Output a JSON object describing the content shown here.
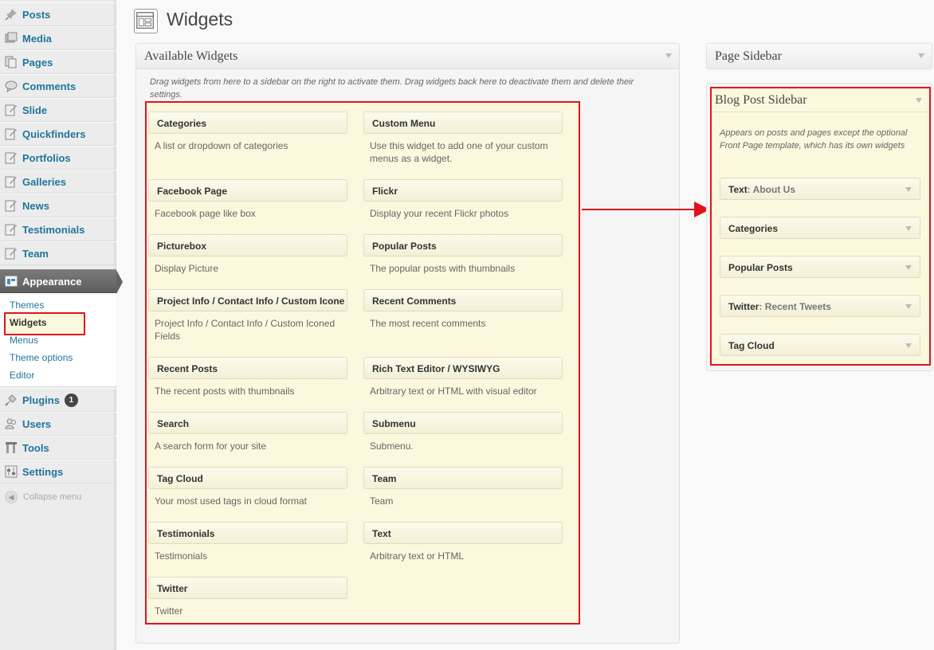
{
  "menu": {
    "items_top": [
      {
        "name": "menu-item-posts",
        "icon": "pin-icon",
        "label": "Posts"
      },
      {
        "name": "menu-item-media",
        "icon": "media-icon",
        "label": "Media"
      },
      {
        "name": "menu-item-pages",
        "icon": "pages-icon",
        "label": "Pages"
      },
      {
        "name": "menu-item-comments",
        "icon": "comment-icon",
        "label": "Comments"
      },
      {
        "name": "menu-item-slide",
        "icon": "edit-icon",
        "label": "Slide"
      },
      {
        "name": "menu-item-quickfinders",
        "icon": "edit-icon",
        "label": "Quickfinders"
      },
      {
        "name": "menu-item-portfolios",
        "icon": "edit-icon",
        "label": "Portfolios"
      },
      {
        "name": "menu-item-galleries",
        "icon": "edit-icon",
        "label": "Galleries"
      },
      {
        "name": "menu-item-news",
        "icon": "edit-icon",
        "label": "News"
      },
      {
        "name": "menu-item-testimonials",
        "icon": "edit-icon",
        "label": "Testimonials"
      },
      {
        "name": "menu-item-team",
        "icon": "edit-icon",
        "label": "Team"
      }
    ],
    "appearance": "Appearance",
    "submenu": [
      "Themes",
      "Widgets",
      "Menus",
      "Theme options",
      "Editor"
    ],
    "items_bottom": [
      {
        "label": "Plugins",
        "icon": "plugin-icon"
      },
      {
        "label": "Users",
        "icon": "users-icon"
      },
      {
        "label": "Tools",
        "icon": "tools-icon"
      },
      {
        "label": "Settings",
        "icon": "settings-icon"
      }
    ],
    "plugins_badge": "1",
    "collapse": "Collapse menu"
  },
  "page": {
    "title": "Widgets",
    "icon": "widgets-page-icon"
  },
  "available": {
    "title": "Available Widgets",
    "description": "Drag widgets from here to a sidebar on the right to activate them. Drag widgets back here to deactivate them and delete their settings.",
    "widgets": [
      {
        "title": "Categories",
        "desc": "A list or dropdown of categories"
      },
      {
        "title": "Custom Menu",
        "desc": "Use this widget to add one of your custom menus as a widget."
      },
      {
        "title": "Facebook Page",
        "desc": "Facebook page like box"
      },
      {
        "title": "Flickr",
        "desc": "Display your recent Flickr photos"
      },
      {
        "title": "Picturebox",
        "desc": "Display Picture"
      },
      {
        "title": "Popular Posts",
        "desc": "The popular posts with thumbnails"
      },
      {
        "title": "Project Info / Contact Info / Custom Icone",
        "desc": "Project Info / Contact Info / Custom Iconed Fields"
      },
      {
        "title": "Recent Comments",
        "desc": "The most recent comments"
      },
      {
        "title": "Recent Posts",
        "desc": "The recent posts with thumbnails"
      },
      {
        "title": "Rich Text Editor / WYSIWYG",
        "desc": "Arbitrary text or HTML with visual editor"
      },
      {
        "title": "Search",
        "desc": "A search form for your site"
      },
      {
        "title": "Submenu",
        "desc": "Submenu."
      },
      {
        "title": "Tag Cloud",
        "desc": "Your most used tags in cloud format"
      },
      {
        "title": "Team",
        "desc": "Team"
      },
      {
        "title": "Testimonials",
        "desc": "Testimonials"
      },
      {
        "title": "Text",
        "desc": "Arbitrary text or HTML"
      },
      {
        "title": "Twitter",
        "desc": "Twitter"
      }
    ]
  },
  "page_sidebar": {
    "title": "Page Sidebar"
  },
  "blog_sidebar": {
    "title": "Blog Post Sidebar",
    "description": "Appears on posts and pages except the optional Front Page template, which has its own widgets",
    "widgets": [
      {
        "title": "Text",
        "subtitle": ": About Us"
      },
      {
        "title": "Categories",
        "subtitle": ""
      },
      {
        "title": "Popular Posts",
        "subtitle": ""
      },
      {
        "title": "Twitter",
        "subtitle": ": Recent Tweets"
      },
      {
        "title": "Tag Cloud",
        "subtitle": ""
      }
    ]
  },
  "colors": {
    "highlight": "#e0141e",
    "link": "#21759b",
    "widget_bg": "#fbf8dd"
  }
}
